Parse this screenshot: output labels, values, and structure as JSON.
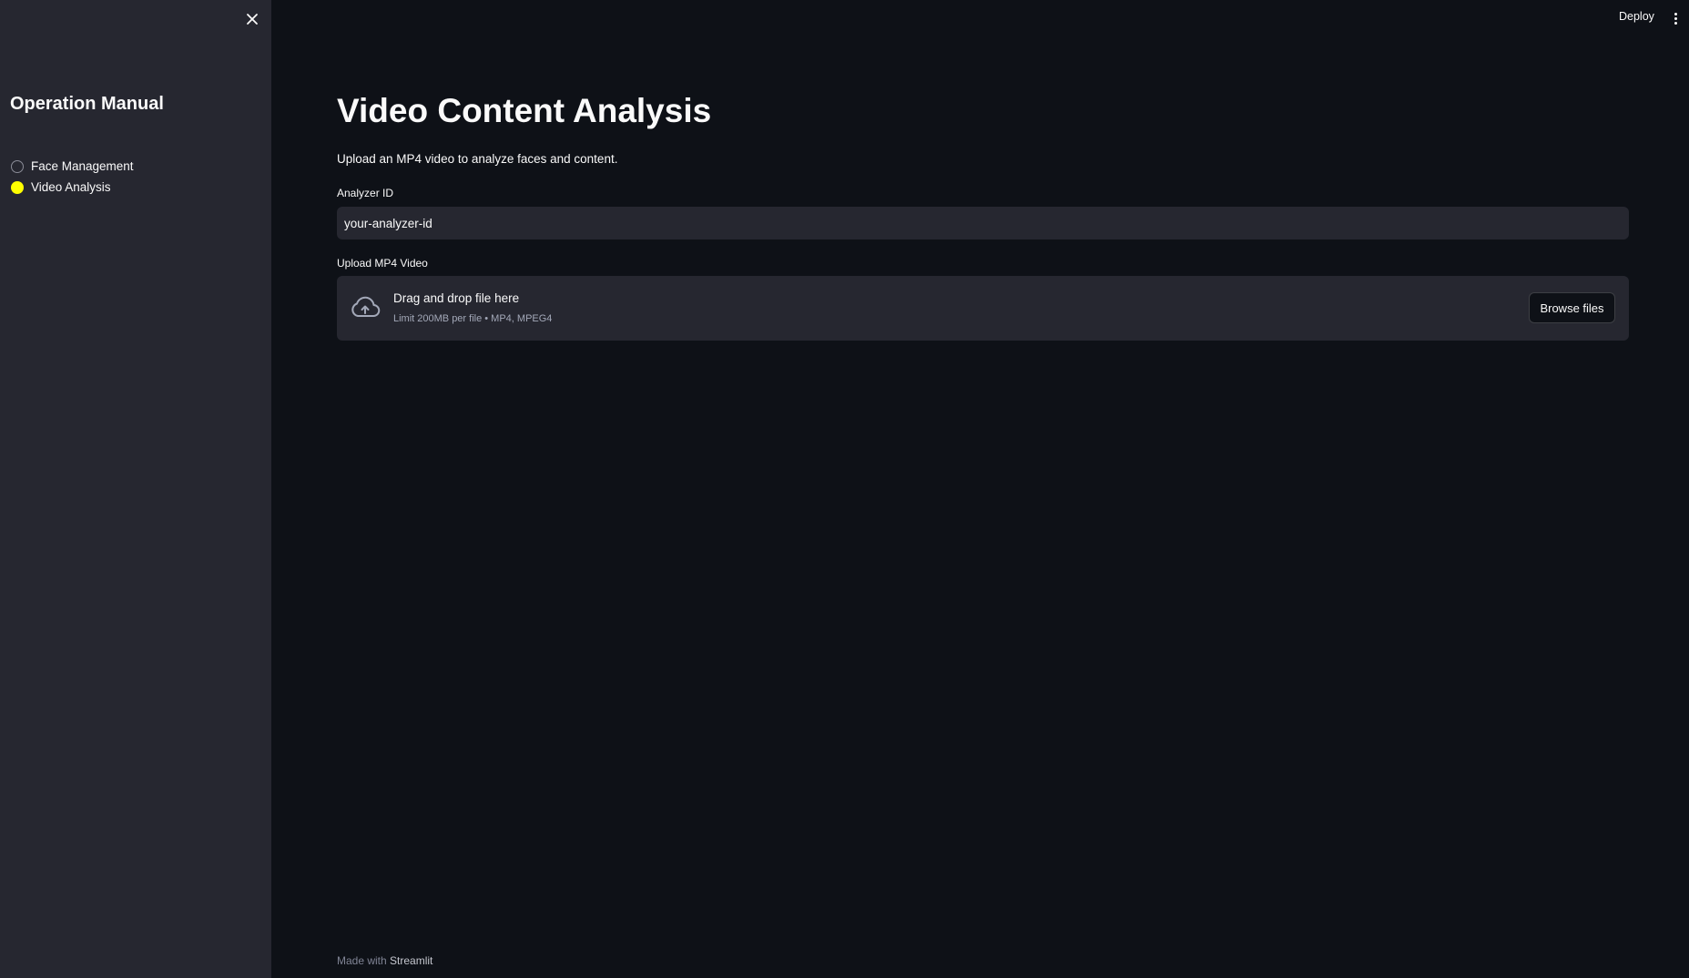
{
  "sidebar": {
    "title": "Operation Manual",
    "options": [
      {
        "label": "Face Management",
        "selected": false
      },
      {
        "label": "Video Analysis",
        "selected": true
      }
    ],
    "close_icon": "close-icon"
  },
  "header": {
    "deploy_label": "Deploy",
    "menu_icon": "kebab-menu-icon"
  },
  "main": {
    "title": "Video Content Analysis",
    "description": "Upload an MP4 video to analyze faces and content.",
    "analyzer_id": {
      "label": "Analyzer ID",
      "value": "your-analyzer-id"
    },
    "upload": {
      "label": "Upload MP4 Video",
      "dropzone_text": "Drag and drop file here",
      "limit_text": "Limit 200MB per file • MP4, MPEG4",
      "browse_label": "Browse files",
      "icon": "cloud-upload-icon"
    }
  },
  "footer": {
    "prefix": "Made with",
    "brand": "Streamlit"
  },
  "colors": {
    "background": "#0e1117",
    "sidebar": "#262730",
    "radio_selected": "#ffff00",
    "text": "#fafafa"
  }
}
